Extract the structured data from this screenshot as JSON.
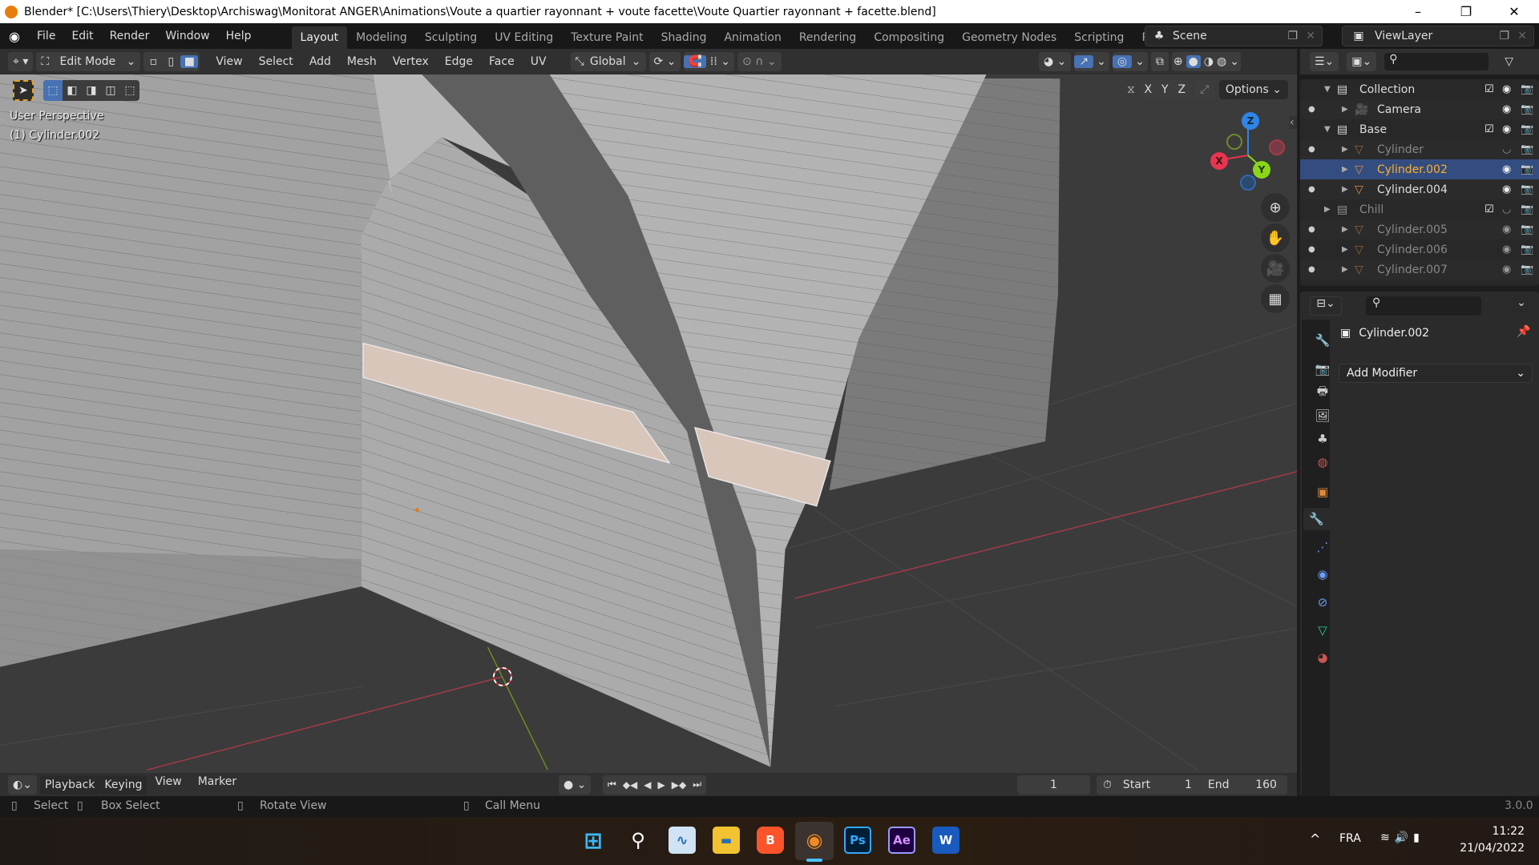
{
  "window": {
    "title": "Blender* [C:\\Users\\Thiery\\Desktop\\Archiswag\\Monitorat ANGER\\Animations\\Voute a quartier rayonnant + voute facette\\Voute Quartier rayonnant + facette.blend]",
    "minimize": "–",
    "maximize": "❐",
    "close": "✕"
  },
  "menus": [
    "File",
    "Edit",
    "Render",
    "Window",
    "Help"
  ],
  "workspaces": [
    {
      "label": "Layout",
      "active": true
    },
    {
      "label": "Modeling"
    },
    {
      "label": "Sculpting"
    },
    {
      "label": "UV Editing"
    },
    {
      "label": "Texture Paint"
    },
    {
      "label": "Shading"
    },
    {
      "label": "Animation"
    },
    {
      "label": "Rendering"
    },
    {
      "label": "Compositing"
    },
    {
      "label": "Geometry Nodes"
    },
    {
      "label": "Scripting"
    },
    {
      "label": "Rendering.("
    }
  ],
  "scene": {
    "name": "Scene",
    "view_layer": "ViewLayer"
  },
  "viewport_header": {
    "mode": "Edit Mode",
    "menus": [
      "View",
      "Select",
      "Add",
      "Mesh",
      "Vertex",
      "Edge",
      "Face",
      "UV"
    ],
    "transform_orientation": "Global",
    "options": "Options",
    "axes": [
      "X",
      "Y",
      "Z"
    ]
  },
  "viewport": {
    "view_name": "User Perspective",
    "object_label": "(1) Cylinder.002",
    "gizmo": {
      "x": "X",
      "y": "Y",
      "z": "Z"
    },
    "colors": {
      "x_axis": "#e8344f",
      "y_axis": "#8ad61a",
      "z_axis": "#2f85e6",
      "selected_face": "#d9c6bb"
    }
  },
  "outliner": {
    "rows": [
      {
        "name": "Collection",
        "type": "collection",
        "level": 0,
        "checked": true,
        "expanded": true
      },
      {
        "name": "Camera",
        "type": "camera",
        "level": 1
      },
      {
        "name": "Base",
        "type": "collection",
        "level": 0,
        "checked": true,
        "expanded": true
      },
      {
        "name": "Cylinder",
        "type": "mesh",
        "level": 1,
        "dim": true,
        "hidden": true
      },
      {
        "name": "Cylinder.002",
        "type": "mesh",
        "level": 1,
        "selected": true
      },
      {
        "name": "Cylinder.004",
        "type": "mesh",
        "level": 1
      },
      {
        "name": "Chill",
        "type": "collection",
        "level": 0,
        "checked": true,
        "dim": true,
        "hidden": true
      },
      {
        "name": "Cylinder.005",
        "type": "mesh",
        "level": 1,
        "dim": true
      },
      {
        "name": "Cylinder.006",
        "type": "mesh",
        "level": 1,
        "dim": true
      },
      {
        "name": "Cylinder.007",
        "type": "mesh",
        "level": 1,
        "dim": true
      }
    ]
  },
  "properties": {
    "object_name": "Cylinder.002",
    "add_modifier": "Add Modifier",
    "active_tab": "modifier-icon",
    "tabs": [
      "tool-icon",
      "render-icon",
      "output-icon",
      "view-layer-icon",
      "scene-icon",
      "world-icon",
      "object-icon",
      "modifier-icon",
      "particles-icon",
      "physics-icon",
      "constraints-icon",
      "data-icon",
      "material-icon"
    ]
  },
  "timeline": {
    "menus": [
      "Playback",
      "Keying",
      "View",
      "Marker"
    ],
    "current_frame": "1",
    "start_label": "Start",
    "start": "1",
    "end_label": "End",
    "end": "160"
  },
  "statusbar": {
    "items": [
      "Select",
      "Box Select",
      "Rotate View",
      "Call Menu"
    ],
    "version": "3.0.0"
  },
  "taskbar": {
    "apps": [
      "Start",
      "Search",
      "Resource Monitor",
      "File Explorer",
      "Brave",
      "Blender",
      "Ps",
      "Ae",
      "W"
    ],
    "language": "FRA",
    "time": "11:22",
    "date": "21/04/2022",
    "chevron": "^"
  }
}
